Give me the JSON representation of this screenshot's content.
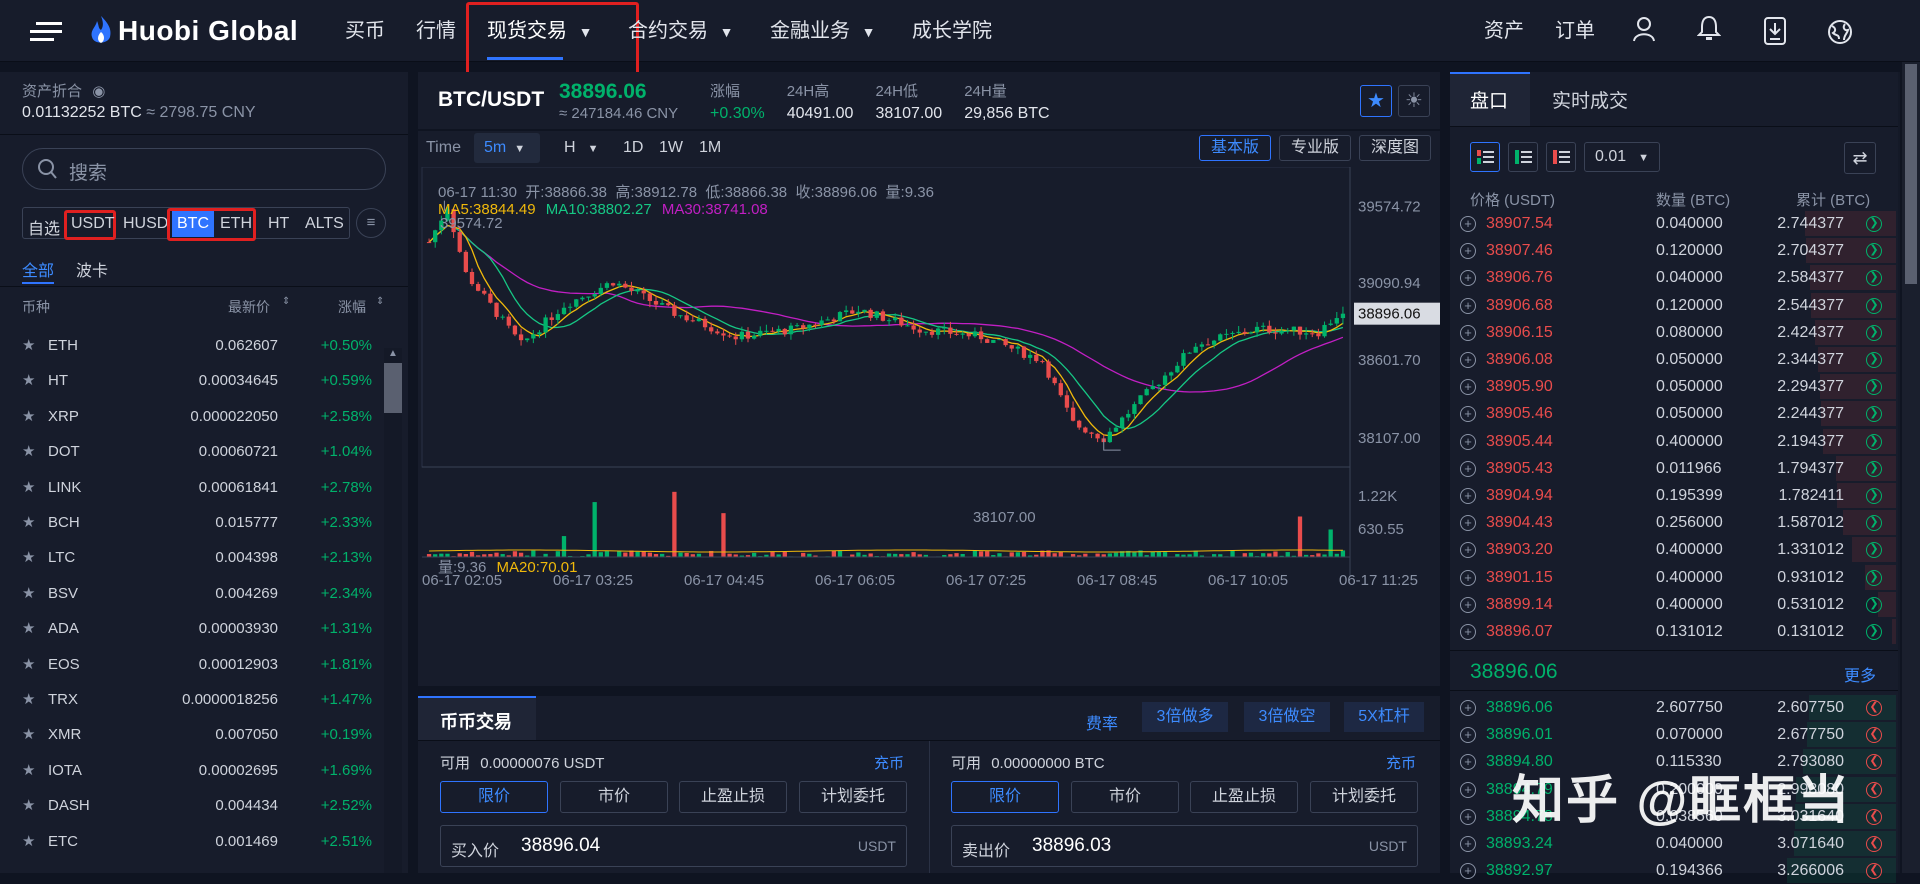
{
  "header": {
    "logo": "Huobi Global",
    "nav": [
      "买币",
      "行情",
      "现货交易",
      "合约交易",
      "金融业务",
      "成长学院"
    ],
    "right": [
      "资产",
      "订单"
    ]
  },
  "assets": {
    "title": "资产折合",
    "value": "0.01132252 BTC",
    "approx": "≈ 2798.75 CNY"
  },
  "search": {
    "placeholder": "搜索"
  },
  "market_tabs": [
    "自选",
    "USDT",
    "HUSD",
    "BTC",
    "ETH",
    "HT",
    "ALTS"
  ],
  "sub_tabs": [
    "全部",
    "波卡"
  ],
  "list_headers": [
    "币种",
    "最新价",
    "涨幅"
  ],
  "coins": [
    {
      "name": "ETH",
      "price": "0.062607",
      "change": "+0.50%"
    },
    {
      "name": "HT",
      "price": "0.00034645",
      "change": "+0.59%"
    },
    {
      "name": "XRP",
      "price": "0.000022050",
      "change": "+2.58%"
    },
    {
      "name": "DOT",
      "price": "0.00060721",
      "change": "+1.04%"
    },
    {
      "name": "LINK",
      "price": "0.00061841",
      "change": "+2.78%"
    },
    {
      "name": "BCH",
      "price": "0.015777",
      "change": "+2.33%"
    },
    {
      "name": "LTC",
      "price": "0.004398",
      "change": "+2.13%"
    },
    {
      "name": "BSV",
      "price": "0.004269",
      "change": "+2.34%"
    },
    {
      "name": "ADA",
      "price": "0.00003930",
      "change": "+1.31%"
    },
    {
      "name": "EOS",
      "price": "0.00012903",
      "change": "+1.81%"
    },
    {
      "name": "TRX",
      "price": "0.0000018256",
      "change": "+1.47%"
    },
    {
      "name": "XMR",
      "price": "0.007050",
      "change": "+0.19%"
    },
    {
      "name": "IOTA",
      "price": "0.00002695",
      "change": "+1.69%"
    },
    {
      "name": "DASH",
      "price": "0.004434",
      "change": "+2.52%"
    },
    {
      "name": "ETC",
      "price": "0.001469",
      "change": "+2.51%"
    }
  ],
  "ticker": {
    "pair": "BTC/USDT",
    "price": "38896.06",
    "cny": "≈ 247184.46 CNY",
    "stats": [
      {
        "label": "涨幅",
        "value": "+0.30%"
      },
      {
        "label": "24H高",
        "value": "40491.00"
      },
      {
        "label": "24H低",
        "value": "38107.00"
      },
      {
        "label": "24H量",
        "value": "29,856 BTC"
      }
    ]
  },
  "chart_toolbar": {
    "time_label": "Time",
    "interval": "5m",
    "h": "H",
    "intervals": [
      "1D",
      "1W",
      "1M"
    ],
    "views": [
      "基本版",
      "专业版",
      "深度图"
    ]
  },
  "chart_info": {
    "ohlc": "06-17 11:30  开:38866.38  高:38912.78  低:38866.38  收:38896.06  量:9.36",
    "ma5": "MA5:38844.49",
    "ma10": "MA10:38802.27",
    "ma30": "MA30:38741.08",
    "vol": "量:9.36",
    "ma20": "MA20:70.01",
    "hi_mark": "39574.72",
    "lo_mark": "38107.00"
  },
  "chart_data": {
    "type": "candlestick",
    "y_ticks": [
      "39574.72",
      "39090.94",
      "38896.06",
      "38601.70",
      "38107.00"
    ],
    "vol_ticks": [
      "1.22K",
      "630.55"
    ],
    "x_ticks": [
      "06-17 02:05",
      "06-17 03:25",
      "06-17 04:45",
      "06-17 06:05",
      "06-17 07:25",
      "06-17 08:45",
      "06-17 10:05",
      "06-17 11:25"
    ],
    "last": 38896.06,
    "high": 39574.72,
    "low": 38107.0
  },
  "colors": {
    "up": "#00b26b",
    "down": "#e94c4c",
    "ma5": "#f0b90b",
    "ma10": "#16c784",
    "ma30": "#c21fc4",
    "accent": "#2f74ff"
  },
  "trade": {
    "title": "币币交易",
    "links": [
      "费率",
      "3倍做多",
      "3倍做空",
      "5X杠杆"
    ],
    "buy": {
      "avail_label": "可用",
      "avail": "0.00000076 USDT",
      "deposit": "充币",
      "types": [
        "限价",
        "市价",
        "止盈止损",
        "计划委托"
      ],
      "price_label": "买入价",
      "price": "38896.04",
      "unit": "USDT"
    },
    "sell": {
      "avail_label": "可用",
      "avail": "0.00000000 BTC",
      "deposit": "充币",
      "types": [
        "限价",
        "市价",
        "止盈止损",
        "计划委托"
      ],
      "price_label": "卖出价",
      "price": "38896.03",
      "unit": "USDT"
    }
  },
  "book": {
    "tabs": [
      "盘口",
      "实时成交"
    ],
    "precision": "0.01",
    "headers": [
      "价格 (USDT)",
      "数量 (BTC)",
      "累计 (BTC)"
    ],
    "asks": [
      [
        "38907.54",
        "0.040000",
        "2.744377"
      ],
      [
        "38907.46",
        "0.120000",
        "2.704377"
      ],
      [
        "38906.76",
        "0.040000",
        "2.584377"
      ],
      [
        "38906.68",
        "0.120000",
        "2.544377"
      ],
      [
        "38906.15",
        "0.080000",
        "2.424377"
      ],
      [
        "38906.08",
        "0.050000",
        "2.344377"
      ],
      [
        "38905.90",
        "0.050000",
        "2.294377"
      ],
      [
        "38905.46",
        "0.050000",
        "2.244377"
      ],
      [
        "38905.44",
        "0.400000",
        "2.194377"
      ],
      [
        "38905.43",
        "0.011966",
        "1.794377"
      ],
      [
        "38904.94",
        "0.195399",
        "1.782411"
      ],
      [
        "38904.43",
        "0.256000",
        "1.587012"
      ],
      [
        "38903.20",
        "0.400000",
        "1.331012"
      ],
      [
        "38901.15",
        "0.400000",
        "0.931012"
      ],
      [
        "38899.14",
        "0.400000",
        "0.531012"
      ],
      [
        "38896.07",
        "0.131012",
        "0.131012"
      ]
    ],
    "last": "38896.06",
    "more": "更多",
    "bids": [
      [
        "38896.06",
        "2.607750",
        "2.607750"
      ],
      [
        "38896.01",
        "0.070000",
        "2.677750"
      ],
      [
        "38894.80",
        "0.115330",
        "2.793080"
      ],
      [
        "38894.79",
        "0.200000",
        "2.993080"
      ],
      [
        "38894.78",
        "0.038560",
        "3.031640"
      ],
      [
        "38893.24",
        "0.040000",
        "3.071640"
      ],
      [
        "38892.97",
        "0.194366",
        "3.266006"
      ]
    ]
  },
  "watermark": "知乎 @眶框当"
}
